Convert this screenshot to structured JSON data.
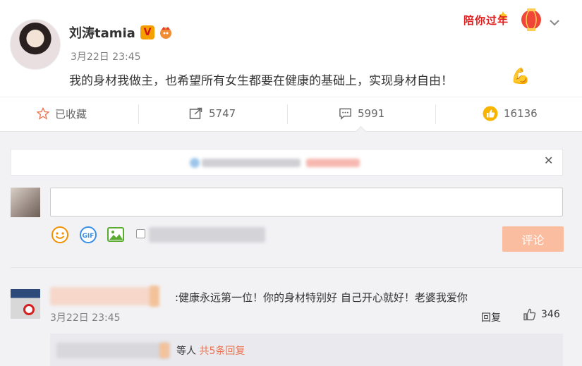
{
  "post": {
    "author": "刘涛tamia",
    "verified_badge": "V",
    "time": "3月22日 23:45",
    "text": "我的身材我做主，也希望所有女生都要在健康的基础上，实现身材自由！",
    "emoji": "muscle-emoji",
    "campaign_badge": "陪你过年"
  },
  "actions": {
    "favorite_label": "已收藏",
    "repost_count": "5747",
    "comment_count": "5991",
    "like_count": "16136"
  },
  "composer": {
    "placeholder": "",
    "submit_label": "评论",
    "tools": [
      "emoji-icon",
      "gif-icon",
      "image-icon"
    ]
  },
  "comments": [
    {
      "text": ":健康永远第一位！你的身材特别好 自己开心就好！老婆我爱你",
      "time": "3月22日 23:45",
      "reply_label": "回复",
      "like_count": "346",
      "replies_summary_prefix": "等人",
      "replies_summary_link": "共5条回复"
    }
  ],
  "colors": {
    "accent_orange": "#eb7350",
    "submit_disabled": "#fbbd9f",
    "comment_bg": "#f2f2f5",
    "like_yellow": "#f7b500"
  }
}
